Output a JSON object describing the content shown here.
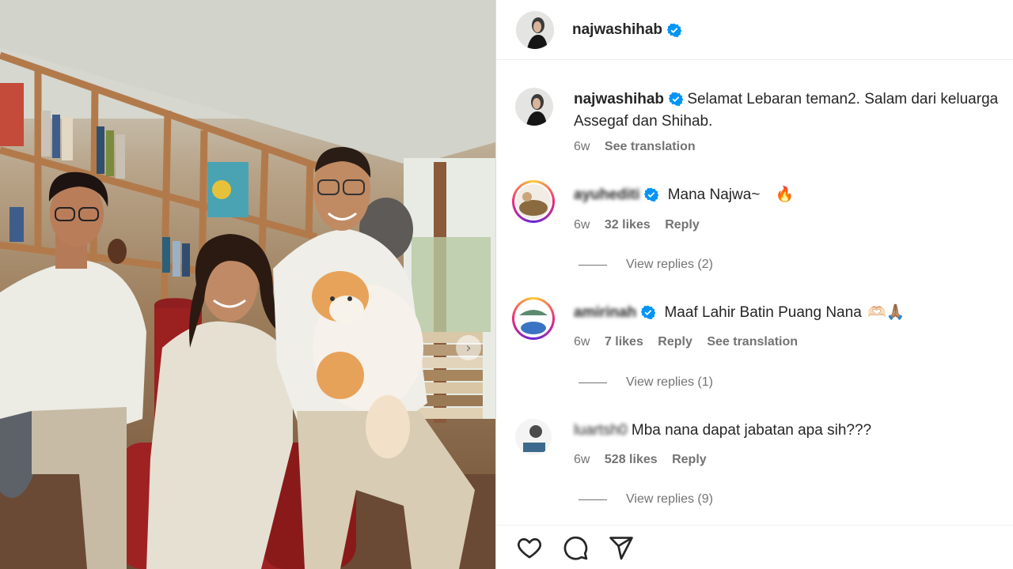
{
  "post": {
    "username": "najwashihab",
    "verified": true
  },
  "caption": {
    "username": "najwashihab",
    "text_line1": "Selamat Lebaran teman2. Salam dari keluarga",
    "text_line2": "Assegaf dan Shihab.",
    "time": "6w",
    "see_translation": "See translation"
  },
  "comments": [
    {
      "username": "ayuhediti",
      "text": "Mana Najwa~",
      "emoji": "🔥",
      "time": "6w",
      "likes": "32 likes",
      "reply": "Reply",
      "view_replies": "View replies (2)"
    },
    {
      "username": "amirinah",
      "text": "Maaf Lahir Batin Puang Nana",
      "emoji": "🫶🏻🙏🏽",
      "time": "6w",
      "likes": "7 likes",
      "reply": "Reply",
      "see_translation": "See translation",
      "view_replies": "View replies (1)"
    },
    {
      "username": "luartsh0",
      "text": "Mba nana dapat jabatan apa sih???",
      "time": "6w",
      "likes": "528 likes",
      "reply": "Reply",
      "view_replies": "View replies (9)"
    }
  ],
  "actions": {
    "like_icon": "heart-icon",
    "comment_icon": "comment-icon",
    "share_icon": "send-icon"
  },
  "colors": {
    "verified_blue": "#0095f6",
    "text_primary": "#262626",
    "text_secondary": "#737373"
  }
}
